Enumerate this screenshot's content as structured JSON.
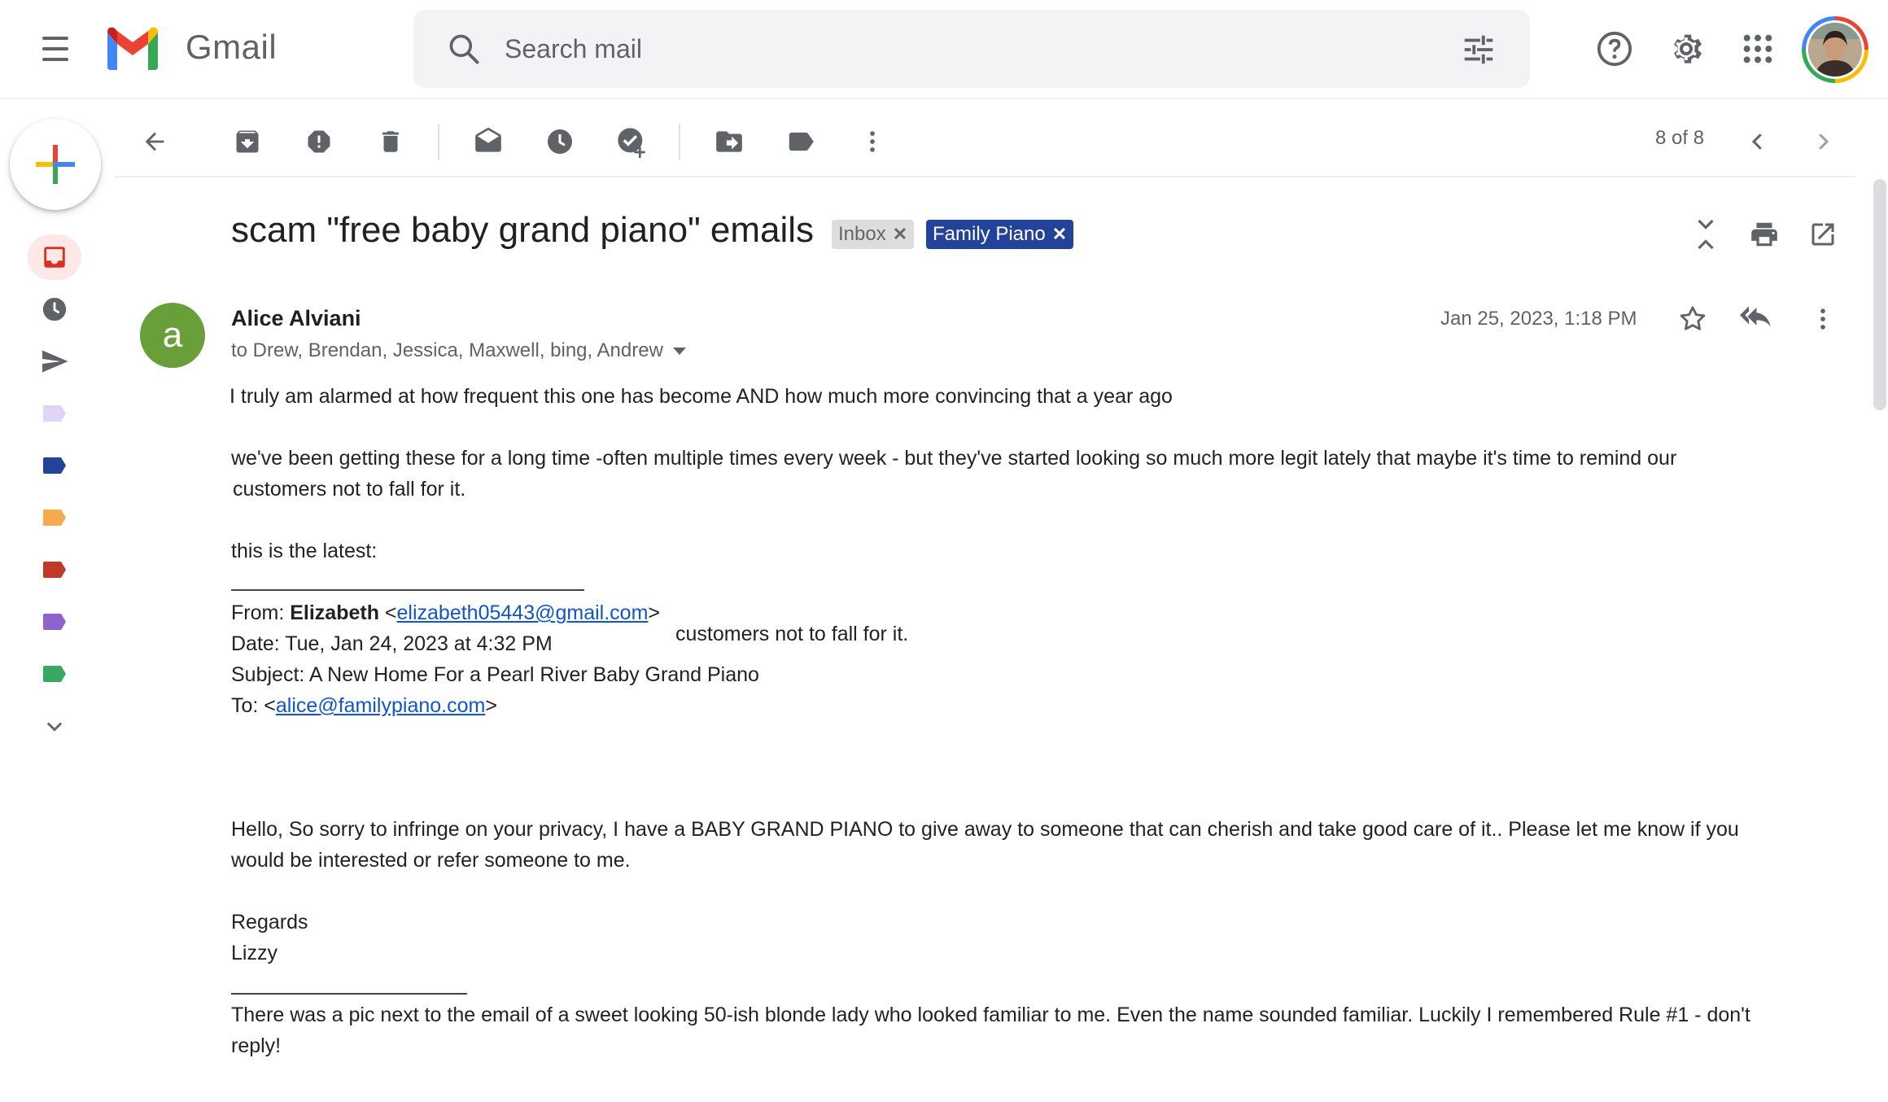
{
  "app": {
    "name": "Gmail"
  },
  "search": {
    "placeholder": "Search mail"
  },
  "toolbar": {
    "pager": "8 of 8"
  },
  "thread": {
    "subject": "scam \"free baby grand piano\" emails",
    "labels": [
      {
        "name": "Inbox",
        "color": "#dddddd"
      },
      {
        "name": "Family Piano",
        "color": "#23439a"
      }
    ]
  },
  "message": {
    "sender_initial": "a",
    "sender_name": "Alice Alviani",
    "recipients": "to Drew, Brendan, Jessica, Maxwell, bing, Andrew",
    "date": "Jan 25, 2023, 1:18 PM",
    "intro": "I truly am alarmed at how frequent this one has become AND how much more convincing that a year ago",
    "para1_line1": "we've been getting these for a long time -often multiple times every week - but they've started looking so much more legit lately that maybe it's time to remind our",
    "para1_line2": "customers not to fall for it.",
    "latest": "this is the latest:",
    "fwd_from_label": "From: ",
    "fwd_from_name": "Elizabeth",
    "fwd_from_email": "elizabeth05443@gmail.com",
    "stray_text": "customers not to fall for it.",
    "fwd_date": "Date: Tue, Jan 24, 2023 at 4:32 PM",
    "fwd_subject": "Subject: A New Home For a Pearl River Baby Grand Piano",
    "fwd_to_label": "To: ",
    "fwd_to_email": "alice@familypiano.com",
    "scam_line1": "Hello, So sorry to infringe on your privacy, I have a BABY GRAND PIANO to give away to someone that can cherish and take good care of it.. Please let me know if you",
    "scam_line2": "would be interested or refer someone to me.",
    "regards": "Regards",
    "signoff": "Lizzy",
    "closing_line1": "There was a pic next to the email of a sweet looking 50-ish blonde lady who looked familiar to me. Even the name sounded familiar.  Luckily I remembered Rule #1 - don't",
    "closing_line2": "reply!"
  },
  "sidebar_label_colors": [
    "#e1d5f7",
    "#23439a",
    "#f6ab4f",
    "#c0392b",
    "#8e63ce",
    "#3aa862"
  ],
  "colors": {
    "accent": "#1a73e8",
    "inbox_active": "#d93025"
  }
}
